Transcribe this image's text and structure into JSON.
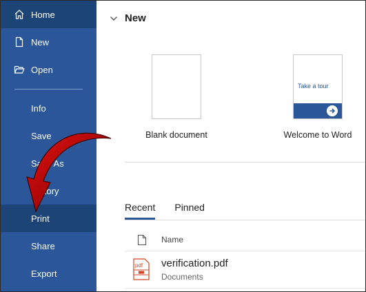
{
  "sidebar": {
    "items": [
      {
        "label": "Home",
        "icon": "home-icon"
      },
      {
        "label": "New",
        "icon": "new-document-icon"
      },
      {
        "label": "Open",
        "icon": "open-folder-icon"
      },
      {
        "label": "Info"
      },
      {
        "label": "Save"
      },
      {
        "label": "Save As"
      },
      {
        "label": "History"
      },
      {
        "label": "Print"
      },
      {
        "label": "Share"
      },
      {
        "label": "Export"
      }
    ]
  },
  "main": {
    "section_title": "New",
    "templates": [
      {
        "caption": "Blank document"
      },
      {
        "caption": "Welcome to Word",
        "thumb_text": "Take a tour"
      }
    ],
    "tabs": [
      {
        "label": "Recent",
        "active": true
      },
      {
        "label": "Pinned",
        "active": false
      }
    ],
    "list_header": {
      "name": "Name"
    },
    "files": [
      {
        "name": "verification.pdf",
        "location": "Documents",
        "icon": "pdf-file-icon",
        "icon_text": "pdf"
      }
    ]
  },
  "colors": {
    "sidebar": "#2b579a",
    "sidebar_active": "#1d4476",
    "annotation_arrow": "#c00000"
  }
}
